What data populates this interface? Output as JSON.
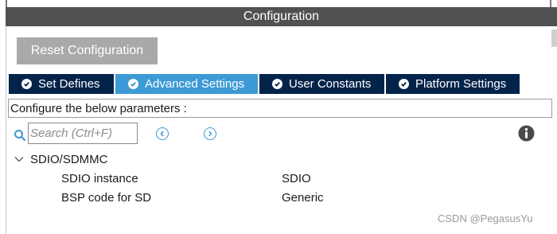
{
  "title": "Configuration",
  "reset_button": "Reset Configuration",
  "tabs": [
    {
      "label": "Set Defines",
      "icon": "check-circle-icon"
    },
    {
      "label": "Advanced Settings",
      "icon": "check-circle-icon",
      "active": true
    },
    {
      "label": "User Constants",
      "icon": "check-circle-icon"
    },
    {
      "label": "Platform Settings",
      "icon": "check-circle-icon"
    }
  ],
  "configure_prompt": "Configure the below parameters :",
  "search": {
    "placeholder": "Search (Ctrl+F)",
    "value": ""
  },
  "group": {
    "label": "SDIO/SDMMC",
    "expanded": true
  },
  "params": [
    {
      "name": "SDIO instance",
      "value": "SDIO"
    },
    {
      "name": "BSP code for SD",
      "value": "Generic"
    }
  ],
  "watermark": "CSDN @PegasusYu",
  "colors": {
    "titlebar": "#4f5152",
    "tab": "#03234b",
    "tab_active": "#3c9ad6",
    "button": "#a8a9ab"
  }
}
